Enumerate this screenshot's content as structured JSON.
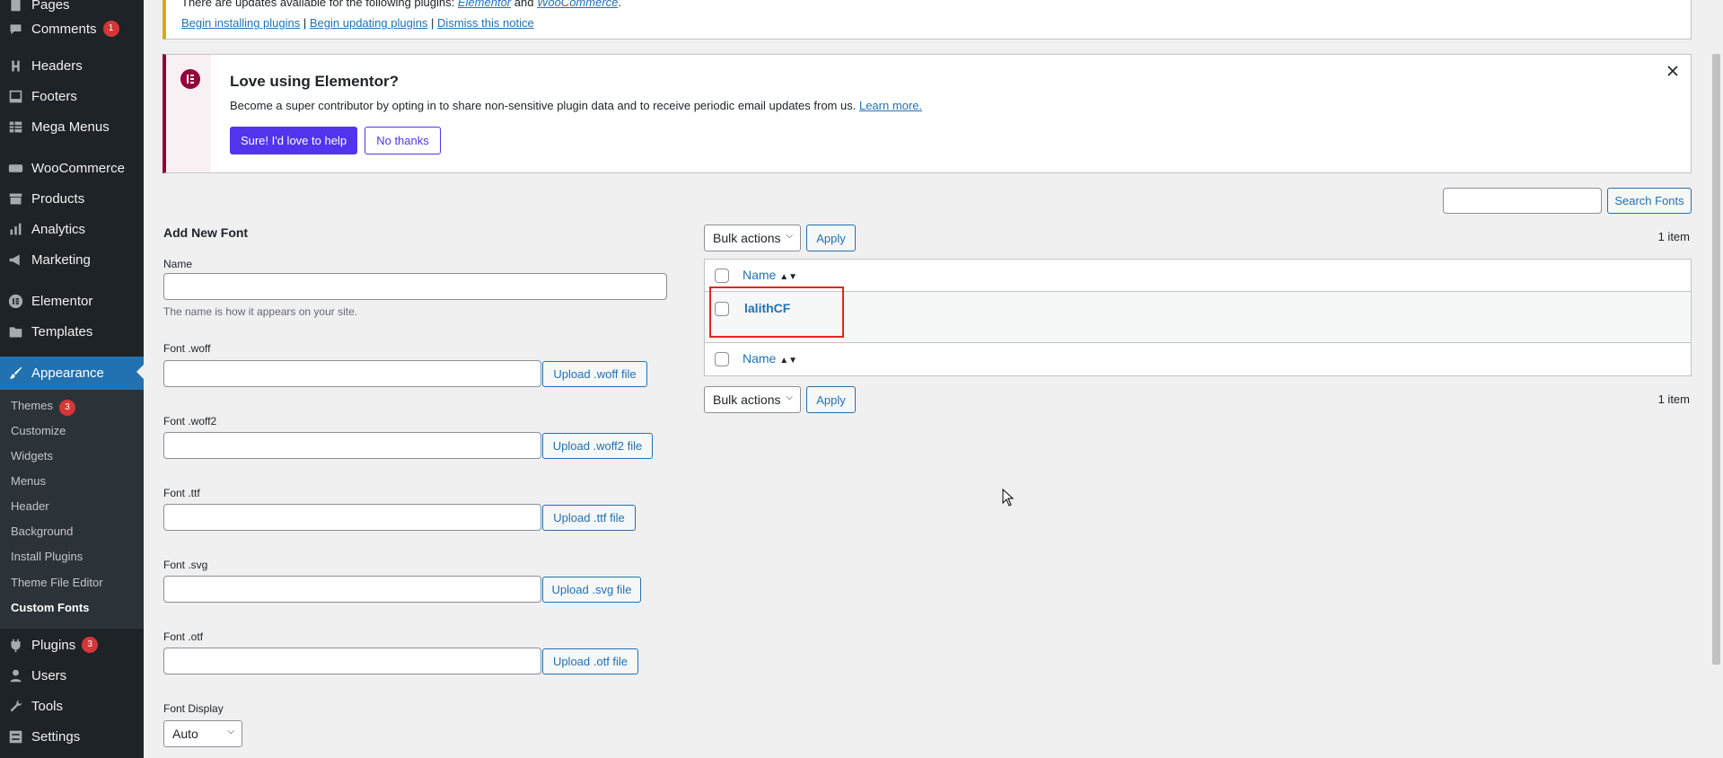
{
  "sidebar": {
    "items": [
      {
        "label": "Pages",
        "icon": "pages-icon"
      },
      {
        "label": "Comments",
        "icon": "comments-icon",
        "badge": "1"
      },
      {
        "label": "Headers",
        "icon": "header-h-icon"
      },
      {
        "label": "Footers",
        "icon": "footer-icon"
      },
      {
        "label": "Mega Menus",
        "icon": "table-icon"
      },
      {
        "label": "WooCommerce",
        "icon": "woocommerce-icon"
      },
      {
        "label": "Products",
        "icon": "archive-icon"
      },
      {
        "label": "Analytics",
        "icon": "bar-chart-icon"
      },
      {
        "label": "Marketing",
        "icon": "megaphone-icon"
      },
      {
        "label": "Elementor",
        "icon": "elementor-icon"
      },
      {
        "label": "Templates",
        "icon": "folder-icon"
      },
      {
        "label": "Appearance",
        "icon": "paintbrush-icon"
      },
      {
        "label": "Plugins",
        "icon": "plug-icon",
        "badge": "3"
      },
      {
        "label": "Users",
        "icon": "user-icon"
      },
      {
        "label": "Tools",
        "icon": "wrench-icon"
      },
      {
        "label": "Settings",
        "icon": "settings-icon"
      }
    ],
    "submenu": [
      {
        "label": "Themes",
        "badge": "3"
      },
      {
        "label": "Customize"
      },
      {
        "label": "Widgets"
      },
      {
        "label": "Menus"
      },
      {
        "label": "Header"
      },
      {
        "label": "Background"
      },
      {
        "label": "Install Plugins"
      },
      {
        "label": "Theme File Editor"
      },
      {
        "label": "Custom Fonts"
      }
    ]
  },
  "update_notice": {
    "text_prefix": "There are updates available for the following plugins:",
    "plugin1": "Elementor",
    "and": "and",
    "plugin2": "WooCommerce",
    "links": [
      "Begin installing plugins",
      "Begin updating plugins",
      "Dismiss this notice"
    ]
  },
  "elementor_notice": {
    "title": "Love using Elementor?",
    "text": "Become a super contributor by opting in to share non-sensitive plugin data and to receive periodic email updates from us.",
    "learn_more": "Learn more.",
    "yes_button": "Sure! I'd love to help",
    "no_button": "No thanks",
    "accent": "#92003b",
    "button_color": "#5234ed"
  },
  "search": {
    "button": "Search Fonts",
    "placeholder": ""
  },
  "add_font": {
    "heading": "Add New Font",
    "name_label": "Name",
    "name_help": "The name is how it appears on your site.",
    "fields": [
      {
        "label": "Font .woff",
        "button": "Upload .woff file"
      },
      {
        "label": "Font .woff2",
        "button": "Upload .woff2 file"
      },
      {
        "label": "Font .ttf",
        "button": "Upload .ttf file"
      },
      {
        "label": "Font .svg",
        "button": "Upload .svg file"
      },
      {
        "label": "Font .otf",
        "button": "Upload .otf file"
      }
    ],
    "display_label": "Font Display",
    "display_value": "Auto"
  },
  "table": {
    "bulk_actions": "Bulk actions",
    "apply": "Apply",
    "count": "1 item",
    "column": "Name",
    "rows": [
      {
        "name": "lalithCF"
      }
    ]
  },
  "colors": {
    "admin_blue": "#2271b1",
    "sidebar_bg": "#1d2327",
    "highlight_box": "#e22626"
  }
}
